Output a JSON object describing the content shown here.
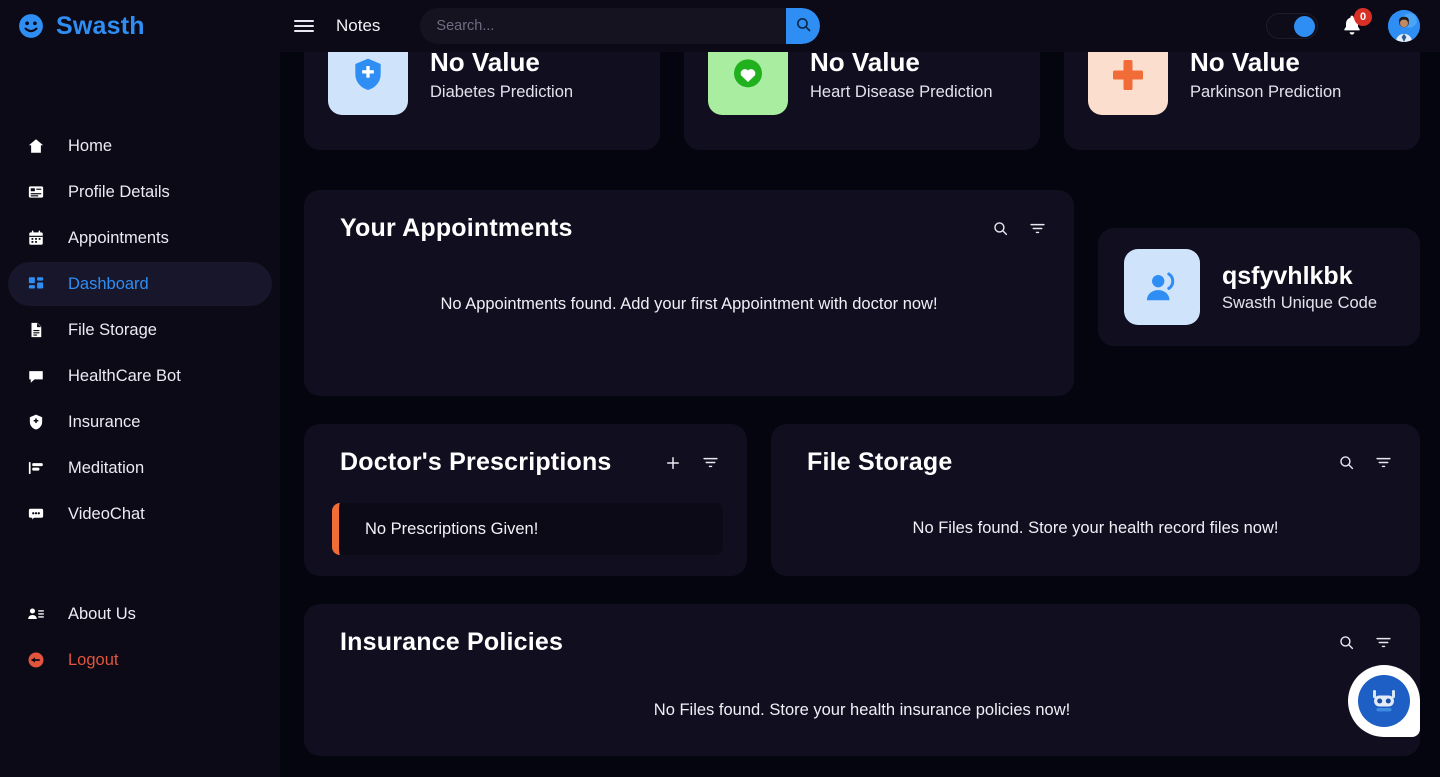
{
  "app": {
    "brand_name": "Swasth",
    "brand_icon": "smiley-face-icon"
  },
  "topbar": {
    "menu_icon": "hamburger-menu-icon",
    "notes_label": "Notes",
    "search": {
      "placeholder": "Search...",
      "value": "",
      "button_icon": "search-icon"
    },
    "theme_toggle": {
      "state": "on",
      "accent": "#2f8ef4"
    },
    "notifications": {
      "icon": "bell-icon",
      "count": "0",
      "badge_color": "#d93025"
    },
    "avatar": "user-avatar"
  },
  "sidebar": {
    "items": [
      {
        "label": "Home",
        "icon": "home-icon",
        "active": false
      },
      {
        "label": "Profile Details",
        "icon": "profile-icon",
        "active": false
      },
      {
        "label": "Appointments",
        "icon": "calendar-icon",
        "active": false
      },
      {
        "label": "Dashboard",
        "icon": "dashboard-icon",
        "active": true
      },
      {
        "label": "File Storage",
        "icon": "document-icon",
        "active": false
      },
      {
        "label": "HealthCare Bot",
        "icon": "chat-icon",
        "active": false
      },
      {
        "label": "Insurance",
        "icon": "shield-icon",
        "active": false
      },
      {
        "label": "Meditation",
        "icon": "meditation-icon",
        "active": false
      },
      {
        "label": "VideoChat",
        "icon": "video-chat-icon",
        "active": false
      }
    ],
    "footer_items": [
      {
        "label": "About Us",
        "icon": "about-icon",
        "danger": false
      },
      {
        "label": "Logout",
        "icon": "logout-icon",
        "danger": true
      }
    ],
    "active_color": "#2f8ef4",
    "danger_color": "#e2553c"
  },
  "stats": [
    {
      "value": "No Value",
      "label": "Diabetes Prediction",
      "icon": "shield-plus-icon",
      "icon_bg": "#cfe4fb",
      "icon_fg": "#2f8ef4"
    },
    {
      "value": "No Value",
      "label": "Heart Disease Prediction",
      "icon": "heart-icon",
      "icon_bg": "#a8eda0",
      "icon_fg": "#22b11e"
    },
    {
      "value": "No Value",
      "label": "Parkinson Prediction",
      "icon": "medical-cross-icon",
      "icon_bg": "#fbdecd",
      "icon_fg": "#f26c38"
    }
  ],
  "appointments": {
    "title": "Your Appointments",
    "empty_message": "No Appointments found. Add your first Appointment with doctor now!",
    "search_icon": "search-icon",
    "filter_icon": "filter-icon"
  },
  "unique_code": {
    "value": "qsfyvhlkbk",
    "label": "Swasth Unique Code",
    "icon": "people-icon"
  },
  "prescriptions": {
    "title": "Doctor's Prescriptions",
    "add_icon": "plus-icon",
    "filter_icon": "filter-icon",
    "empty_message": "No Prescriptions Given!",
    "accent_color": "#f26c38"
  },
  "file_storage": {
    "title": "File Storage",
    "empty_message": "No Files found. Store your health record files now!",
    "search_icon": "search-icon",
    "filter_icon": "filter-icon"
  },
  "insurance": {
    "title": "Insurance Policies",
    "empty_message": "No Files found. Store your health insurance policies now!",
    "search_icon": "search-icon",
    "filter_icon": "filter-icon"
  },
  "chatbot": {
    "icon": "chatbot-robot-icon"
  }
}
